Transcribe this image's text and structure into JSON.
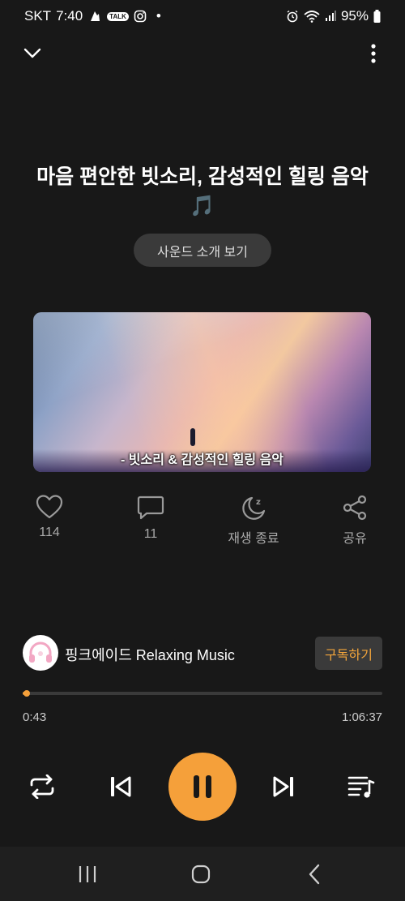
{
  "status_bar": {
    "carrier": "SKT",
    "time": "7:40",
    "talk_badge": "TALK",
    "dot": "•",
    "battery": "95%"
  },
  "track": {
    "title": "마음 편안한 빗소리, 감성적인 힐링 음악🎵",
    "intro_button": "사운드 소개 보기",
    "artwork_caption": "- 빗소리 & 감성적인 힐링 음악"
  },
  "actions": {
    "like_count": "114",
    "comment_count": "11",
    "sleep_label": "재생 종료",
    "share_label": "공유"
  },
  "channel": {
    "name": "핑크에이드 Relaxing Music",
    "subscribe_label": "구독하기"
  },
  "progress": {
    "elapsed": "0:43",
    "duration": "1:06:37",
    "fraction": 0.011
  },
  "colors": {
    "accent": "#f5a03a",
    "background": "#181818"
  },
  "icons": [
    "chevron-down-icon",
    "more-vert-icon",
    "heart-icon",
    "comment-icon",
    "sleep-timer-icon",
    "share-icon",
    "repeat-icon",
    "skip-previous-icon",
    "pause-icon",
    "skip-next-icon",
    "playlist-icon",
    "recents-icon",
    "home-icon",
    "back-icon"
  ]
}
